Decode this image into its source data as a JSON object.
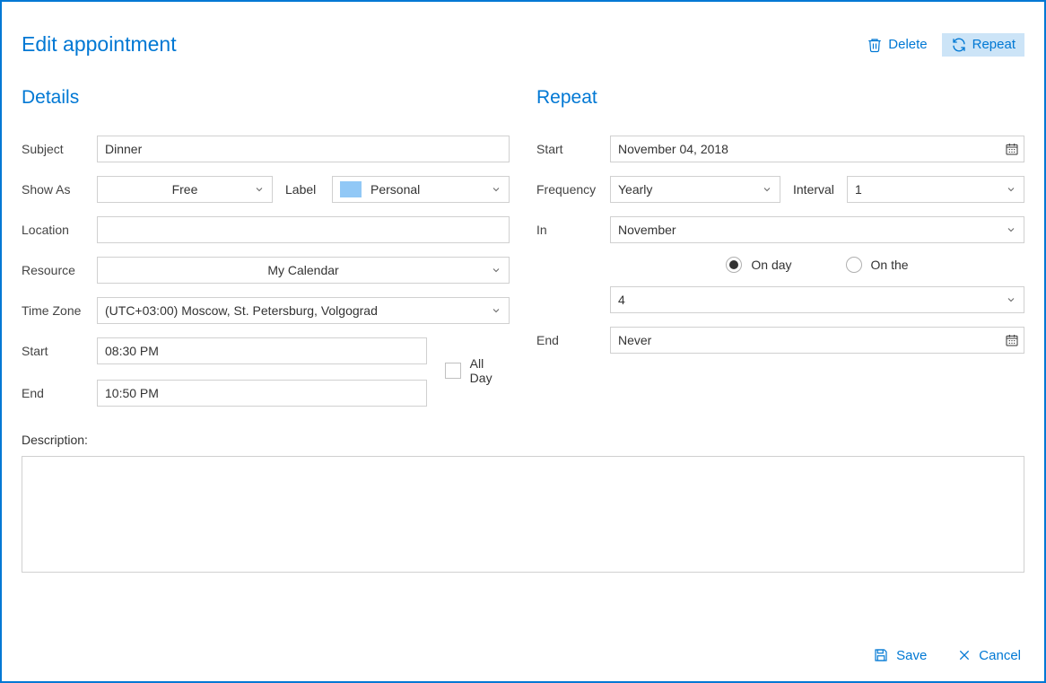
{
  "header": {
    "title": "Edit appointment",
    "delete_label": "Delete",
    "repeat_label": "Repeat"
  },
  "details": {
    "heading": "Details",
    "subject_label": "Subject",
    "subject_value": "Dinner",
    "show_as_label": "Show As",
    "show_as_value": "Free",
    "label_caption": "Label",
    "label_value": "Personal",
    "location_label": "Location",
    "location_value": "",
    "resource_label": "Resource",
    "resource_value": "My Calendar",
    "timezone_label": "Time Zone",
    "timezone_value": "(UTC+03:00) Moscow, St. Petersburg, Volgograd",
    "start_label": "Start",
    "start_value": "08:30 PM",
    "end_label": "End",
    "end_value": "10:50 PM",
    "allday_label": "All Day",
    "description_label": "Description:",
    "description_value": ""
  },
  "repeat": {
    "heading": "Repeat",
    "start_label": "Start",
    "start_value": "November 04, 2018",
    "frequency_label": "Frequency",
    "frequency_value": "Yearly",
    "interval_label": "Interval",
    "interval_value": "1",
    "in_label": "In",
    "in_value": "November",
    "on_day_label": "On day",
    "on_the_label": "On the",
    "day_value": "4",
    "end_label": "End",
    "end_value": "Never"
  },
  "footer": {
    "save_label": "Save",
    "cancel_label": "Cancel"
  }
}
